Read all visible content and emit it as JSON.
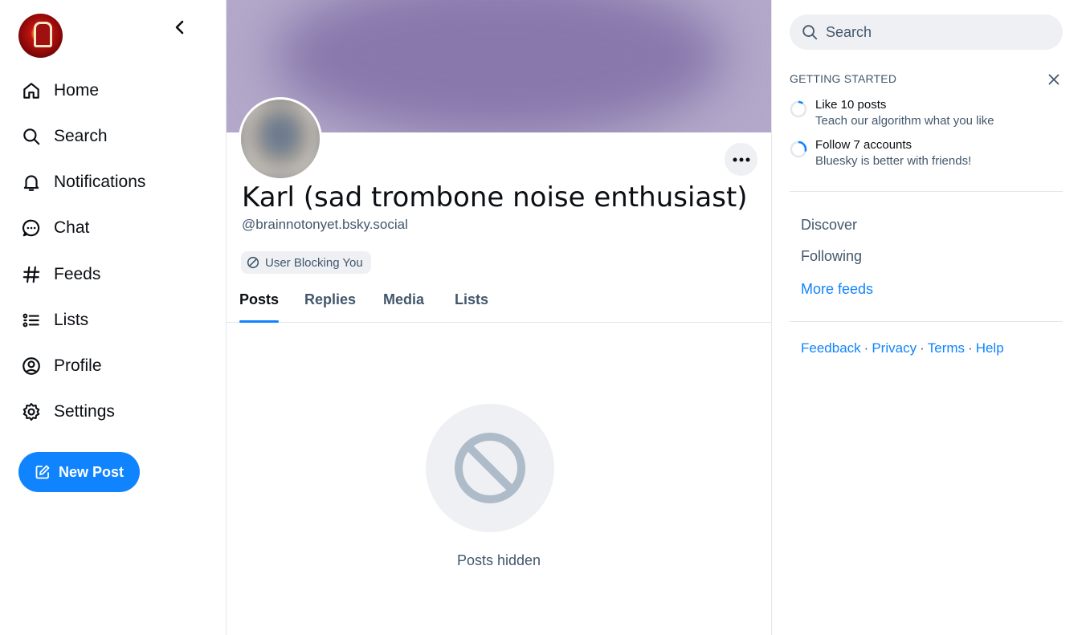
{
  "nav": {
    "items": [
      {
        "label": "Home",
        "icon": "home-icon"
      },
      {
        "label": "Search",
        "icon": "search-icon"
      },
      {
        "label": "Notifications",
        "icon": "bell-icon"
      },
      {
        "label": "Chat",
        "icon": "chat-icon"
      },
      {
        "label": "Feeds",
        "icon": "hash-icon"
      },
      {
        "label": "Lists",
        "icon": "list-icon"
      },
      {
        "label": "Profile",
        "icon": "user-circle-icon"
      },
      {
        "label": "Settings",
        "icon": "gear-icon"
      }
    ],
    "new_post_label": "New Post"
  },
  "profile": {
    "display_name": "Karl (sad trombone noise enthusiast)",
    "handle": "@brainnotonyet.bsky.social",
    "block_status": "User Blocking You",
    "tabs": [
      "Posts",
      "Replies",
      "Media",
      "Lists"
    ],
    "active_tab": "Posts",
    "hidden_message": "Posts hidden"
  },
  "sidebar": {
    "search_placeholder": "Search",
    "getting_started": {
      "title": "GETTING STARTED",
      "tasks": [
        {
          "title": "Like 10 posts",
          "subtitle": "Teach our algorithm what you like",
          "progress": 0.1
        },
        {
          "title": "Follow 7 accounts",
          "subtitle": "Bluesky is better with friends!",
          "progress": 0.3
        }
      ]
    },
    "feeds": [
      "Discover",
      "Following",
      "More feeds"
    ],
    "footer": [
      "Feedback",
      "Privacy",
      "Terms",
      "Help"
    ]
  },
  "colors": {
    "accent": "#1083fe",
    "muted_text": "#42576c",
    "surface": "#eef0f3",
    "banner": "#8878ac"
  }
}
